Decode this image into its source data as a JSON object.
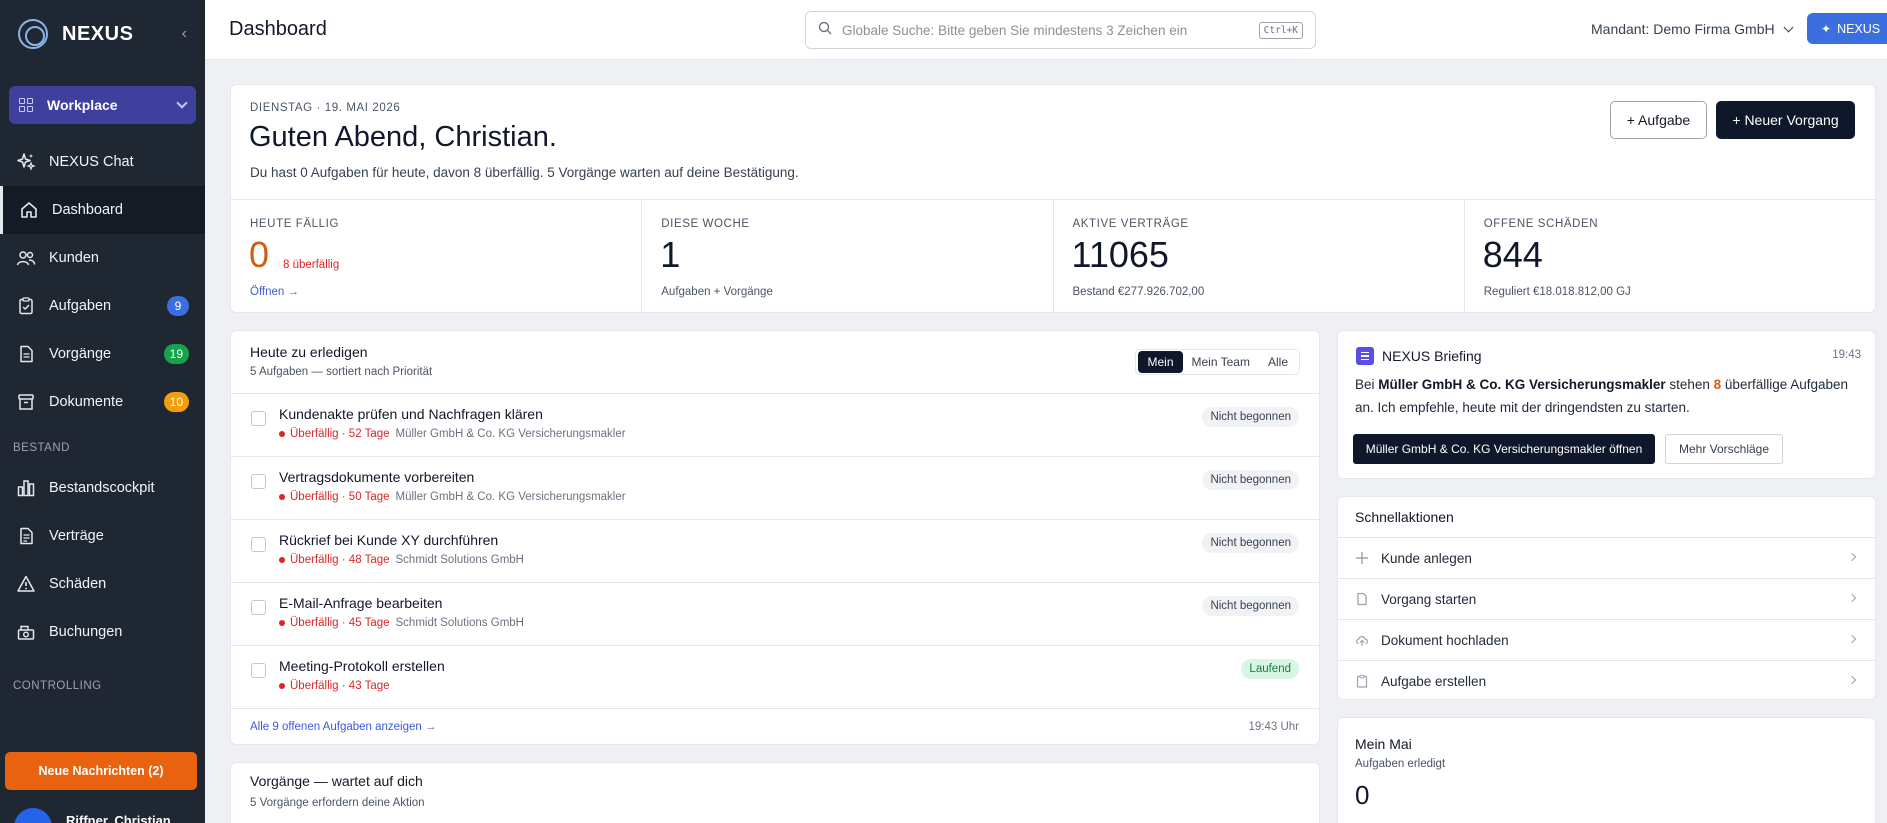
{
  "app": {
    "brand": "NEXUS",
    "page_title": "Dashboard"
  },
  "sidebar": {
    "workplace_label": "Workplace",
    "items": [
      {
        "label": "NEXUS Chat"
      },
      {
        "label": "Dashboard"
      },
      {
        "label": "Kunden"
      },
      {
        "label": "Aufgaben",
        "badge": "9"
      },
      {
        "label": "Vorgänge",
        "badge": "19"
      },
      {
        "label": "Dokumente",
        "badge": "10"
      }
    ],
    "section_bestand": "BESTAND",
    "bestand_items": [
      {
        "label": "Bestandscockpit"
      },
      {
        "label": "Verträge"
      },
      {
        "label": "Schäden"
      },
      {
        "label": "Buchungen"
      }
    ],
    "section_controlling": "CONTROLLING",
    "news_button": "Neue Nachrichten (2)",
    "user_name": "Riffner, Christian"
  },
  "topbar": {
    "search_placeholder": "Globale Suche: Bitte geben Sie mindestens 3 Zeichen ein",
    "search_shortcut": "Ctrl+K",
    "mandant": "Mandant: Demo Firma GmbH",
    "nexus_button": "NEXUS"
  },
  "hero": {
    "date": "DIENSTAG · 19. MAI 2026",
    "greeting": "Guten Abend, Christian.",
    "subtitle": "Du hast 0 Aufgaben für heute, davon 8 überfällig. 5 Vorgänge warten auf deine Bestätigung.",
    "btn_task": "+ Aufgabe",
    "btn_case": "+ Neuer Vorgang"
  },
  "stats": [
    {
      "label": "HEUTE FÄLLIG",
      "value": "0",
      "overdue": "8 überfällig",
      "foot": "Öffnen →"
    },
    {
      "label": "DIESE WOCHE",
      "value": "1",
      "foot": "Aufgaben + Vorgänge"
    },
    {
      "label": "AKTIVE VERTRÄGE",
      "value": "11065",
      "foot": "Bestand €277.926.702,00"
    },
    {
      "label": "OFFENE SCHÄDEN",
      "value": "844",
      "foot": "Reguliert €18.018.812,00 GJ"
    }
  ],
  "tasks": {
    "title": "Heute zu erledigen",
    "subtitle": "5 Aufgaben — sortiert nach Priorität",
    "filters": [
      "Mein",
      "Mein Team",
      "Alle"
    ],
    "items": [
      {
        "title": "Kundenakte prüfen und Nachfragen klären",
        "due": "Überfällig · 52 Tage",
        "customer": "Müller GmbH & Co. KG Versicherungsmakler",
        "status": "Nicht begonnen"
      },
      {
        "title": "Vertragsdokumente vorbereiten",
        "due": "Überfällig · 50 Tage",
        "customer": "Müller GmbH & Co. KG Versicherungsmakler",
        "status": "Nicht begonnen"
      },
      {
        "title": "Rückrief bei Kunde XY durchführen",
        "due": "Überfällig · 48 Tage",
        "customer": "Schmidt Solutions GmbH",
        "status": "Nicht begonnen"
      },
      {
        "title": "E-Mail-Anfrage bearbeiten",
        "due": "Überfällig · 45 Tage",
        "customer": "Schmidt Solutions GmbH",
        "status": "Nicht begonnen"
      },
      {
        "title": "Meeting-Protokoll erstellen",
        "due": "Überfällig · 43 Tage",
        "customer": "",
        "status": "Laufend"
      }
    ],
    "footer_link": "Alle 9 offenen Aufgaben anzeigen →",
    "footer_time": "19:43 Uhr"
  },
  "vorgaenge": {
    "title": "Vorgänge — wartet auf dich",
    "subtitle": "5 Vorgänge erfordern deine Aktion"
  },
  "briefing": {
    "title": "NEXUS Briefing",
    "time": "19:43",
    "text_pre": "Bei ",
    "company": "Müller GmbH & Co. KG Versicherungsmakler",
    "text_mid": " stehen ",
    "count": "8",
    "text_post": " überfällige Aufgaben an. Ich empfehle, heute mit der dringendsten zu starten.",
    "btn_open": "Müller GmbH & Co. KG Versicherungsmakler öffnen",
    "btn_more": "Mehr Vorschläge"
  },
  "quick": {
    "title": "Schnellaktionen",
    "items": [
      {
        "label": "Kunde anlegen"
      },
      {
        "label": "Vorgang starten"
      },
      {
        "label": "Dokument hochladen"
      },
      {
        "label": "Aufgabe erstellen"
      }
    ]
  },
  "mai": {
    "title": "Mein Mai",
    "subtitle": "Aufgaben erledigt",
    "value": "0"
  }
}
